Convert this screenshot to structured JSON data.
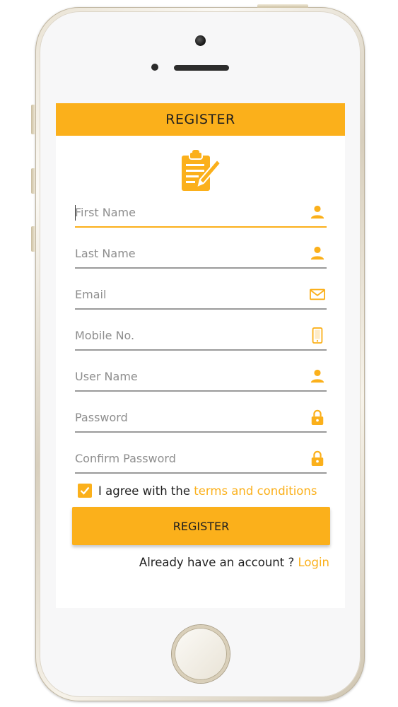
{
  "header": {
    "title": "REGISTER"
  },
  "form": {
    "fields": [
      {
        "placeholder": "First Name",
        "icon": "user-icon"
      },
      {
        "placeholder": "Last Name",
        "icon": "user-icon"
      },
      {
        "placeholder": "Email",
        "icon": "mail-icon"
      },
      {
        "placeholder": "Mobile No.",
        "icon": "mobile-icon"
      },
      {
        "placeholder": "User Name",
        "icon": "user-icon"
      },
      {
        "placeholder": "Password",
        "icon": "lock-icon"
      },
      {
        "placeholder": "Confirm Password",
        "icon": "lock-icon"
      }
    ],
    "agree": {
      "checked": true,
      "text": "I agree with the ",
      "link": "terms and conditions"
    },
    "submit_label": "REGISTER",
    "login": {
      "text": "Already have an account ? ",
      "link": "Login"
    }
  },
  "colors": {
    "accent": "#fbb01b",
    "text": "#1f1f1f",
    "placeholder": "#8e8e8e",
    "underline": "#9a9a9a"
  }
}
